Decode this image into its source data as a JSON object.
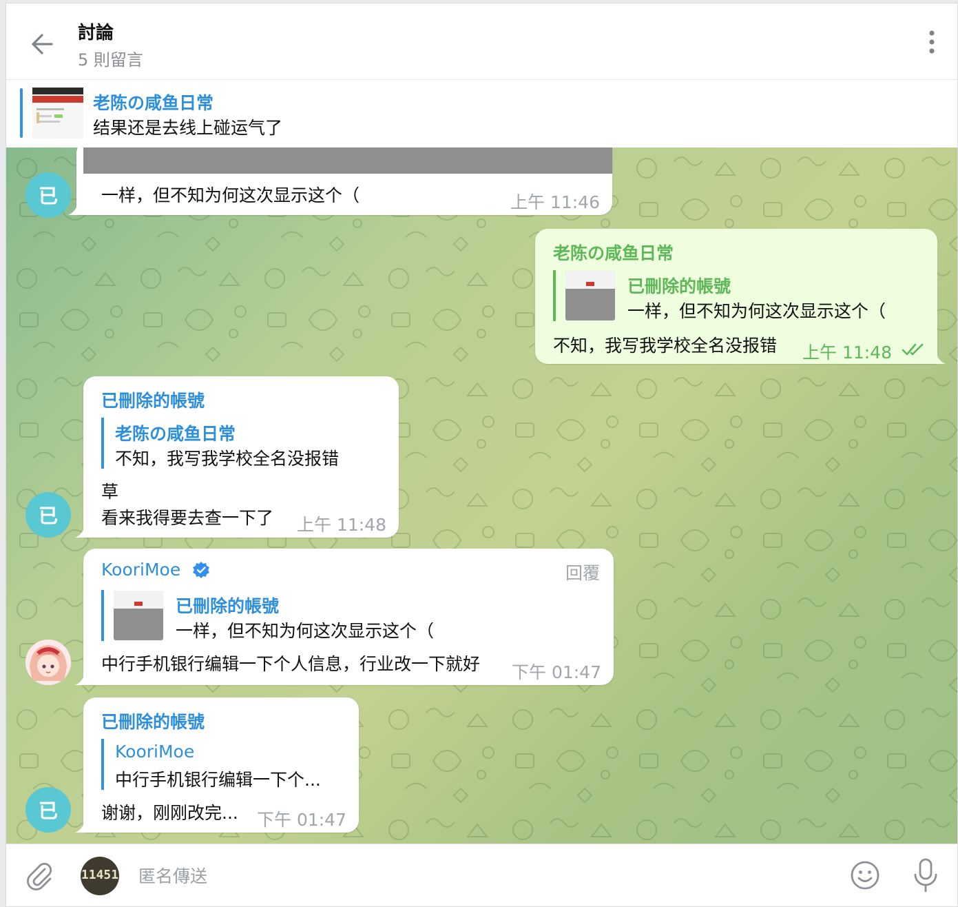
{
  "header": {
    "title": "討論",
    "subtitle": "5 則留言",
    "back_icon": "arrow-left-icon",
    "menu_icon": "more-vertical-icon"
  },
  "pinned": {
    "name": "老陈の咸鱼日常",
    "text": "结果还是去线上碰运气了"
  },
  "colors": {
    "accent": "#3390ec",
    "name_blue": "#2e8fdc",
    "out_green": "#5fb858",
    "out_bubble": "#eefedf",
    "avatar_teal": "#5ac8d3"
  },
  "messages": [
    {
      "id": "m1",
      "avatar": "已",
      "text": "一样，但不知为何这次显示这个（",
      "time": "上午 11:46"
    },
    {
      "id": "m2",
      "sender": "老陈の咸鱼日常",
      "reply_name": "已刪除的帳號",
      "reply_text": "一样，但不知为何这次显示这个（",
      "text": "不知，我写我学校全名没报错",
      "time": "上午 11:48",
      "status_icon": "double-check-icon"
    },
    {
      "id": "m3",
      "avatar": "已",
      "sender": "已刪除的帳號",
      "reply_name": "老陈の咸鱼日常",
      "reply_text": "不知，我写我学校全名没报错",
      "line1": "草",
      "line2": "看来我得要去查一下了",
      "time": "上午 11:48"
    },
    {
      "id": "m4",
      "sender": "KooriMoe",
      "reply_action": "回覆",
      "reply_name": "已刪除的帳號",
      "reply_text": "一样，但不知为何这次显示这个（",
      "text": "中行手机银行编辑一下个人信息，行业改一下就好",
      "time": "下午 01:47"
    },
    {
      "id": "m5",
      "avatar": "已",
      "sender": "已刪除的帳號",
      "reply_name": "KooriMoe",
      "reply_text": "中行手机银行编辑一下个...",
      "text": "谢谢，刚刚改完...",
      "time": "下午 01:47"
    }
  ],
  "composer": {
    "placeholder": "匿名傳送",
    "send_as_text": "11451"
  }
}
